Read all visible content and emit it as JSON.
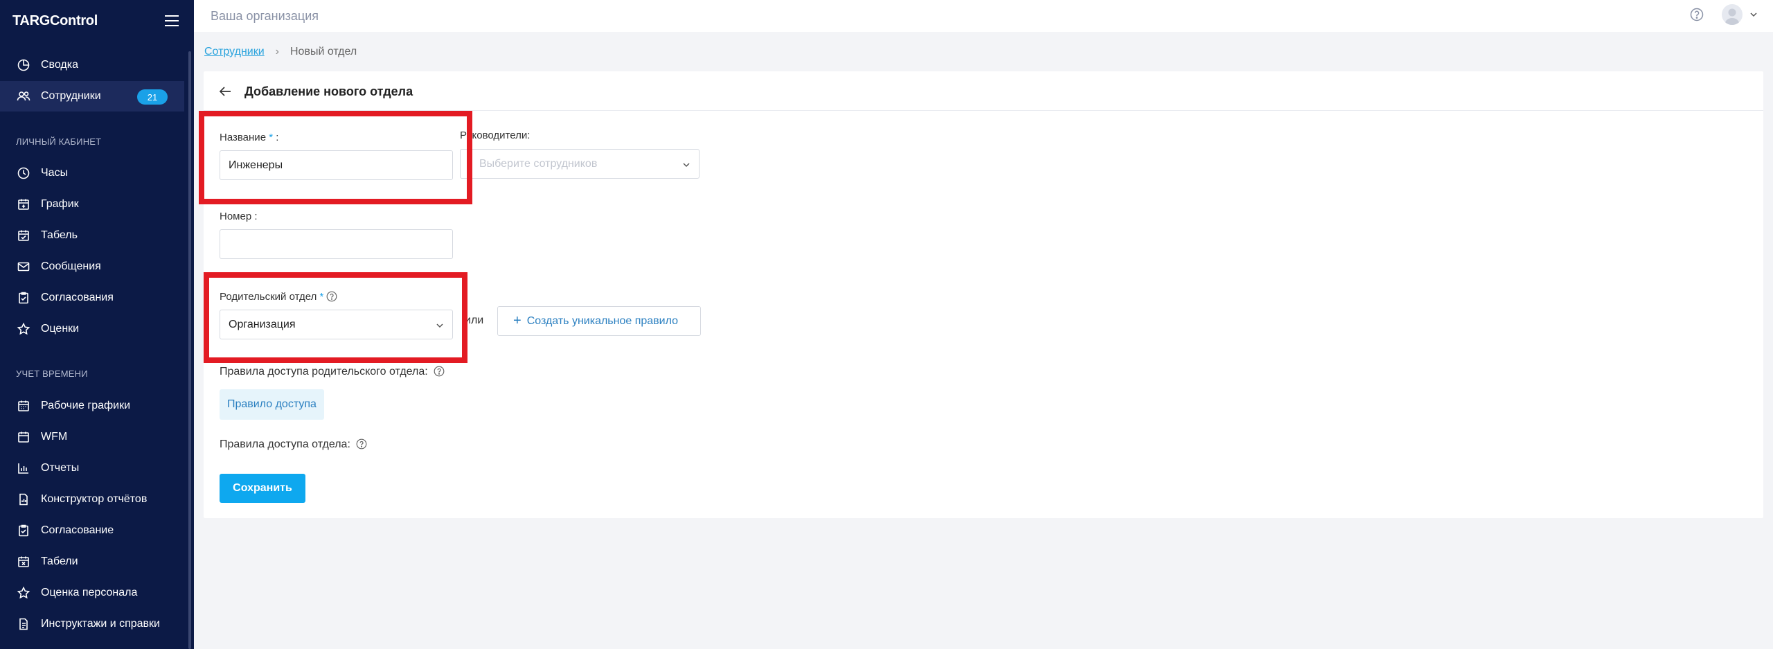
{
  "sidebar": {
    "brand": "TARGControl",
    "top_items": [
      {
        "label": "Сводка",
        "icon": "chart-pie-icon"
      },
      {
        "label": "Сотрудники",
        "icon": "users-icon",
        "badge": "21"
      }
    ],
    "section1_title": "ЛИЧНЫЙ КАБИНЕТ",
    "section1_items": [
      {
        "label": "Часы",
        "icon": "clock-icon"
      },
      {
        "label": "График",
        "icon": "calendar-plus-icon"
      },
      {
        "label": "Табель",
        "icon": "calendar-check-icon"
      },
      {
        "label": "Сообщения",
        "icon": "mail-icon"
      },
      {
        "label": "Согласования",
        "icon": "clipboard-check-icon"
      },
      {
        "label": "Оценки",
        "icon": "star-icon"
      }
    ],
    "section2_title": "УЧЕТ ВРЕМЕНИ",
    "section2_items": [
      {
        "label": "Рабочие графики",
        "icon": "calendar-grid-icon"
      },
      {
        "label": "WFM",
        "icon": "calendar-icon"
      },
      {
        "label": "Отчеты",
        "icon": "bar-chart-icon"
      },
      {
        "label": "Конструктор отчётов",
        "icon": "document-chart-icon"
      },
      {
        "label": "Согласование",
        "icon": "clipboard-check-icon"
      },
      {
        "label": "Табели",
        "icon": "calendar-x-icon"
      },
      {
        "label": "Оценка персонала",
        "icon": "star-icon"
      },
      {
        "label": "Инструктажи и справки",
        "icon": "document-icon"
      }
    ]
  },
  "topbar": {
    "org": "Ваша организация"
  },
  "breadcrumb": {
    "parent": "Сотрудники",
    "current": "Новый отдел"
  },
  "form": {
    "title": "Добавление нового отдела",
    "name_label": "Название",
    "name_value": "Инженеры",
    "heads_label": "Руководители:",
    "heads_placeholder": "Выберите сотрудников",
    "number_label": "Номер",
    "number_value": "",
    "parent_label": "Родительский отдел",
    "parent_value": "Организация",
    "or_text": "или",
    "create_rule_label": "Создать уникальное правило",
    "parent_rules_label": "Правила доступа родительского отдела:",
    "rule_chip": "Правило доступа",
    "dept_rules_label": "Правила доступа отдела:",
    "save_label": "Сохранить"
  },
  "colors": {
    "sidebar": "#0c1a46",
    "accent": "#0ea8ef",
    "highlight": "#e31b23"
  }
}
